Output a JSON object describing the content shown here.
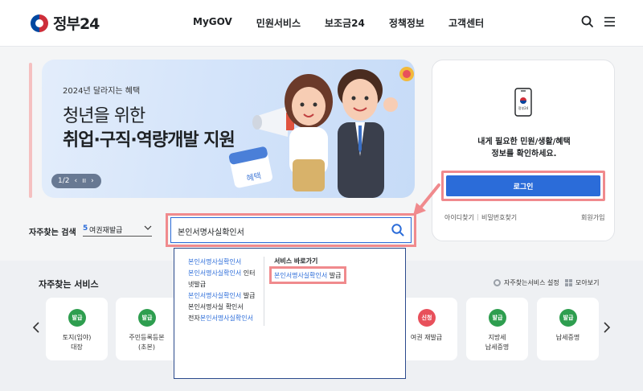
{
  "header": {
    "logo_text": "정부24",
    "nav": [
      "MyGOV",
      "민원서비스",
      "보조금24",
      "정책정보",
      "고객센터"
    ],
    "icons": [
      "search-icon",
      "hamburger-menu-icon"
    ]
  },
  "banner": {
    "small_text": "2024년 달라지는 혜택",
    "title_line1": "청년을 위한",
    "title_line2": "취업·구직·역량개발 지원",
    "pager": "1/2",
    "calendar_label": "혜택"
  },
  "login": {
    "phone_label": "정부24",
    "message_line1": "내게 필요한 민원/생활/혜택",
    "message_line2": "정보를 확인하세요.",
    "button": "로그인",
    "find_id": "아이디찾기",
    "find_password": "비밀번호찾기",
    "signup": "회원가입"
  },
  "frequent": {
    "label": "자주찾는 검색",
    "number": "5",
    "value": "여권재발급"
  },
  "search": {
    "value": "본인서명사실확인서"
  },
  "services": {
    "title": "자주찾는 서비스",
    "settings": "자주찾는서비스 설정",
    "view_all": "모아보기",
    "cards": [
      {
        "badge": "발급",
        "name1": "토지(임야)",
        "name2": "대장",
        "color": "#2e9e4f"
      },
      {
        "badge": "발급",
        "name1": "주민등록등본",
        "name2": "(초본)",
        "color": "#2e9e4f"
      },
      {
        "badge": "신청",
        "name1": "여권 재발급",
        "name2": "",
        "color": "#e8505b"
      },
      {
        "badge": "발급",
        "name1": "지방세",
        "name2": "납세증명",
        "color": "#2e9e4f"
      },
      {
        "badge": "발급",
        "name1": "납세증명",
        "name2": "",
        "color": "#2e9e4f"
      }
    ]
  },
  "dropdown": {
    "item1_hl": "본인서명사실확인서",
    "item2_hl": "본인서명사실확인서",
    "item2_rest": " 인터",
    "item2b": "넷발급",
    "item3_hl": "본인서명사실확인서",
    "item3_rest": " 발급",
    "item4": "본인서명사실 확인서",
    "item5_pre": "전자",
    "item5_hl": "본인서명사실확인서",
    "shortcut_title": "서비스 바로가기",
    "shortcut_hl": "본인서명사실확인서",
    "shortcut_rest": " 발급"
  },
  "colors": {
    "accent": "#2b6cd9",
    "highlight": "#f08a8d",
    "issue_badge": "#2e9e4f",
    "apply_badge": "#e8505b"
  }
}
